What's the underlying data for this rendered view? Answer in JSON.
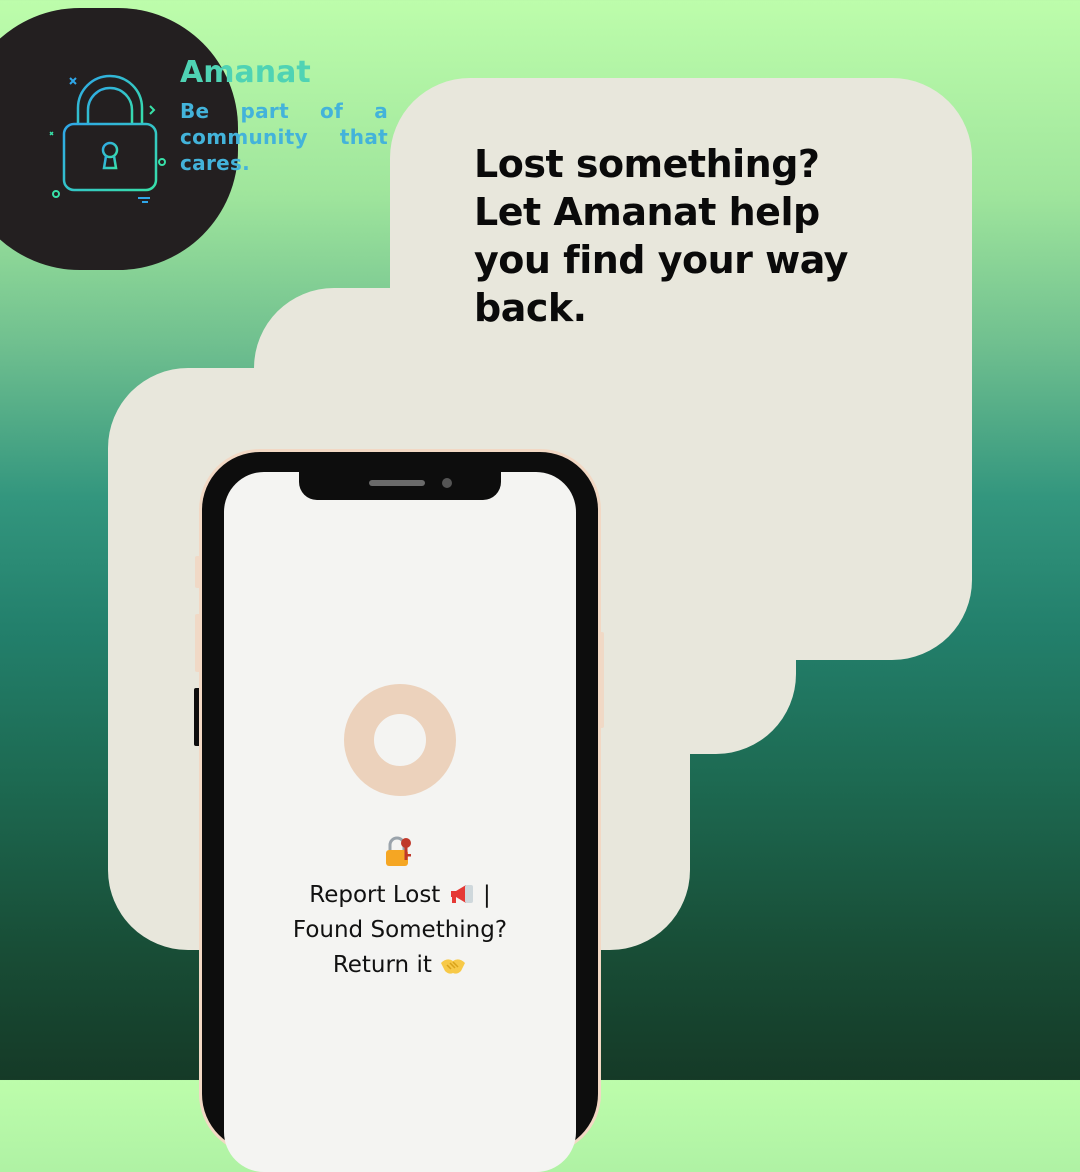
{
  "brand": {
    "name": "Amanat",
    "tagline": "Be part of a community that cares."
  },
  "headline": "Lost something? Let Amanat help you find your way back.",
  "phone_screen": {
    "line1_text": "Report Lost",
    "line1_icon": "megaphone-icon",
    "line1_separator": "|",
    "line2_text": "Found Something?",
    "line3_text": "Return it",
    "line3_icon": "handshake-icon",
    "top_icon": "locked-with-key-icon"
  },
  "colors": {
    "brand_teal": "#4fd3b4",
    "tagline_blue": "#43b3da",
    "cream_panel": "#e8e7dc",
    "logo_background": "#231f20",
    "phone_accent": "#ecd2bc"
  }
}
